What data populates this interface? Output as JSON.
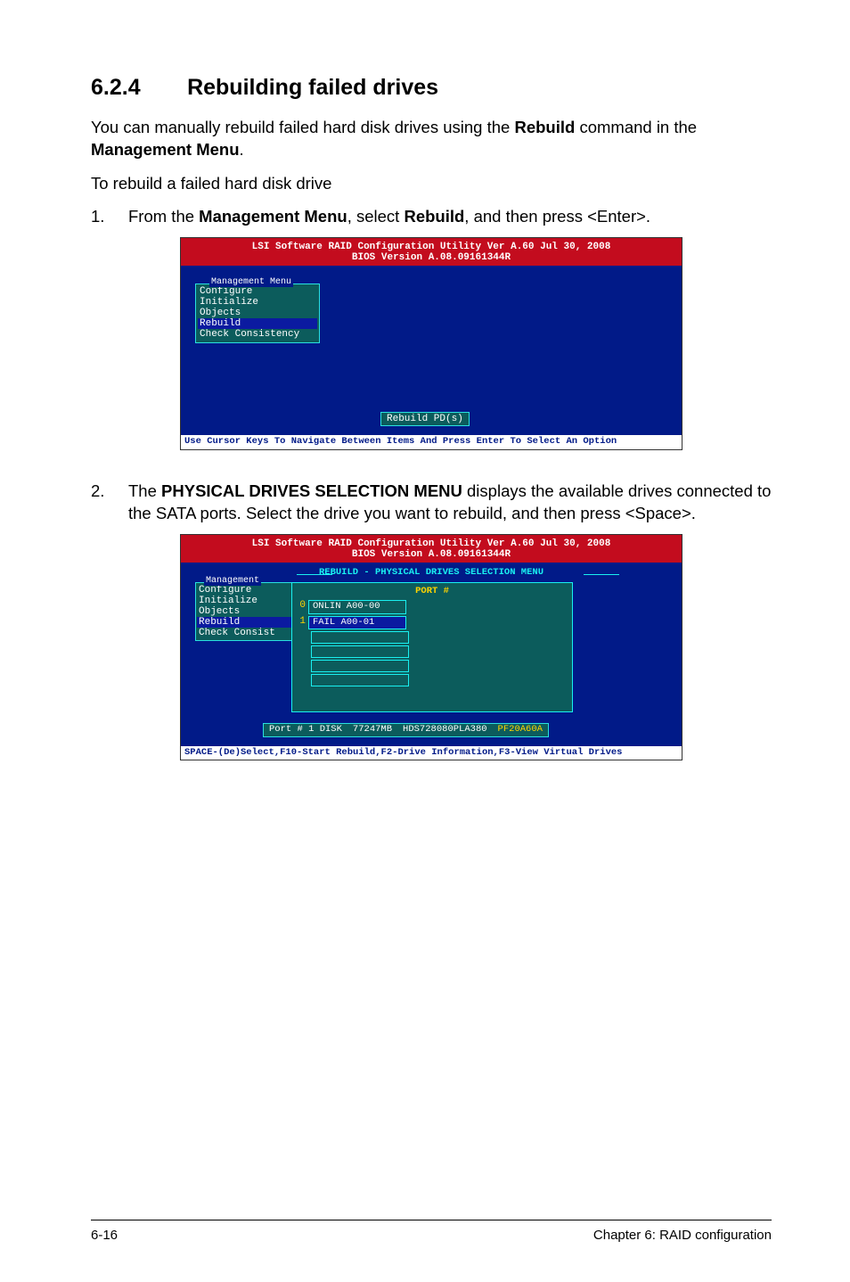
{
  "heading": {
    "num": "6.2.4",
    "title": "Rebuilding failed drives"
  },
  "lead": {
    "pre": "You can manually rebuild failed hard disk drives using the ",
    "b1": "Rebuild",
    "mid": " command in the ",
    "b2": "Management Menu",
    "post": "."
  },
  "step_intro": "To rebuild a failed hard disk drive",
  "steps": {
    "s1": {
      "num": "1.",
      "pre": "From the ",
      "b1": "Management Menu",
      "mid": ", select ",
      "b2": "Rebuild",
      "post": ", and then press <Enter>."
    },
    "s2": {
      "num": "2.",
      "pre": "The ",
      "b1": "PHYSICAL DRIVES SELECTION MENU",
      "post1": " displays the available drives connected to the SATA ports. Select the drive you want to rebuild, and then press <Space>."
    }
  },
  "ss1": {
    "top1": "LSI Software RAID Configuration Utility Ver A.60 Jul 30, 2008",
    "top2": "BIOS Version   A.08.09161344R",
    "menu_title": "Management Menu",
    "items": [
      "Configure",
      "Initialize",
      "Objects",
      "Rebuild",
      "Check Consistency"
    ],
    "selected_index": 3,
    "hint": "Rebuild PD(s)",
    "bottom": "Use Cursor Keys To Navigate Between Items And Press Enter To Select An Option"
  },
  "ss2": {
    "top1": "LSI Software RAID Configuration Utility Ver A.60 Jul 30, 2008",
    "top2": "BIOS Version   A.08.09161344R",
    "panel_title": "REBUILD - PHYSICAL DRIVES SELECTION MENU",
    "port_hdr": "PORT #",
    "drives": [
      {
        "idx": "0",
        "label": "ONLIN A00-00",
        "sel": false
      },
      {
        "idx": "1",
        "label": "FAIL  A00-01",
        "sel": true
      }
    ],
    "menu_title": "Management",
    "items": [
      "Configure",
      "Initialize",
      "Objects",
      "Rebuild",
      "Check Consist"
    ],
    "info": {
      "a": "Port # 1 DISK",
      "b": "77247MB",
      "c": "HDS728080PLA380",
      "d": "PF20A60A"
    },
    "bottom": "SPACE-(De)Select,F10-Start Rebuild,F2-Drive Information,F3-View Virtual Drives"
  },
  "footer": {
    "left": "6-16",
    "right": "Chapter 6: RAID configuration"
  }
}
